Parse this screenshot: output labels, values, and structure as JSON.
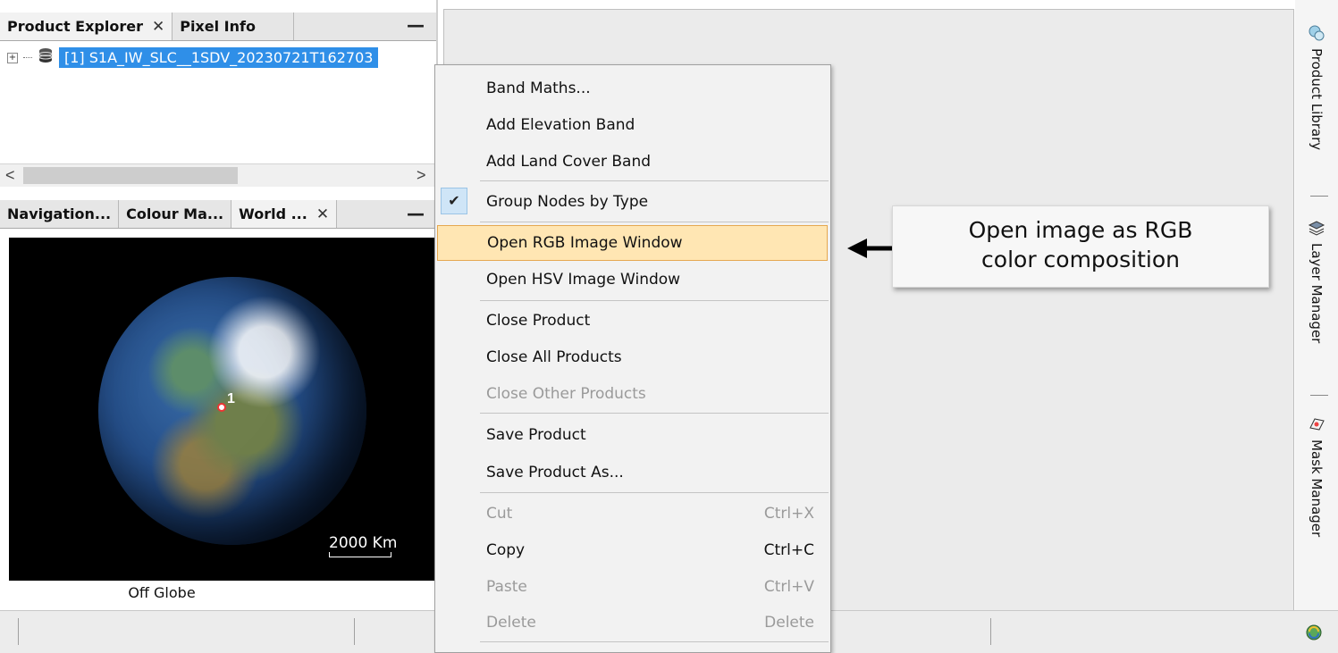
{
  "top_panel": {
    "tabs": [
      {
        "label": "Product Explorer",
        "close": "✕"
      },
      {
        "label": "Pixel Info"
      }
    ],
    "minimize": "—",
    "tree": {
      "expander": "⊞",
      "product_label": "[1] S1A_IW_SLC__1SDV_20230721T162703"
    },
    "scroll_left": "<",
    "scroll_right": ">"
  },
  "bottom_panel": {
    "tabs": [
      {
        "label": "Navigation..."
      },
      {
        "label": "Colour Ma..."
      },
      {
        "label": "World ...",
        "close": "✕"
      }
    ],
    "minimize": "—",
    "marker_label": "1",
    "scale_label": "2000 Km",
    "off_globe": "Off Globe"
  },
  "context_menu": {
    "items": [
      {
        "label": "Band Maths...",
        "shortcut": "",
        "enabled": true
      },
      {
        "label": "Add Elevation Band",
        "shortcut": "",
        "enabled": true
      },
      {
        "label": "Add Land Cover Band",
        "shortcut": "",
        "enabled": true
      },
      {
        "label": "Group Nodes by Type",
        "shortcut": "",
        "enabled": true,
        "checked": true
      },
      {
        "label": "Open RGB Image Window",
        "shortcut": "",
        "enabled": true,
        "highlighted": true
      },
      {
        "label": "Open HSV Image Window",
        "shortcut": "",
        "enabled": true
      },
      {
        "label": "Close Product",
        "shortcut": "",
        "enabled": true
      },
      {
        "label": "Close All Products",
        "shortcut": "",
        "enabled": true
      },
      {
        "label": "Close Other Products",
        "shortcut": "",
        "enabled": false
      },
      {
        "label": "Save Product",
        "shortcut": "",
        "enabled": true
      },
      {
        "label": "Save Product As...",
        "shortcut": "",
        "enabled": true
      },
      {
        "label": "Cut",
        "shortcut": "Ctrl+X",
        "enabled": false
      },
      {
        "label": "Copy",
        "shortcut": "Ctrl+C",
        "enabled": true
      },
      {
        "label": "Paste",
        "shortcut": "Ctrl+V",
        "enabled": false
      },
      {
        "label": "Delete",
        "shortcut": "Delete",
        "enabled": false
      }
    ],
    "check_glyph": "✔"
  },
  "callout": {
    "line1": "Open image as RGB",
    "line2": "color composition"
  },
  "sidebar": {
    "items": [
      {
        "label": "Product Library",
        "icon": "library-icon"
      },
      {
        "label": "Layer Manager",
        "icon": "layers-icon"
      },
      {
        "label": "Mask Manager",
        "icon": "mask-icon"
      }
    ],
    "bottom_icon": "refresh-globe-icon"
  },
  "colors": {
    "selection": "#2f8fe8",
    "menu_highlight": "#ffe6b3",
    "menu_highlight_border": "#e5a850",
    "globe_background": "#000000"
  }
}
